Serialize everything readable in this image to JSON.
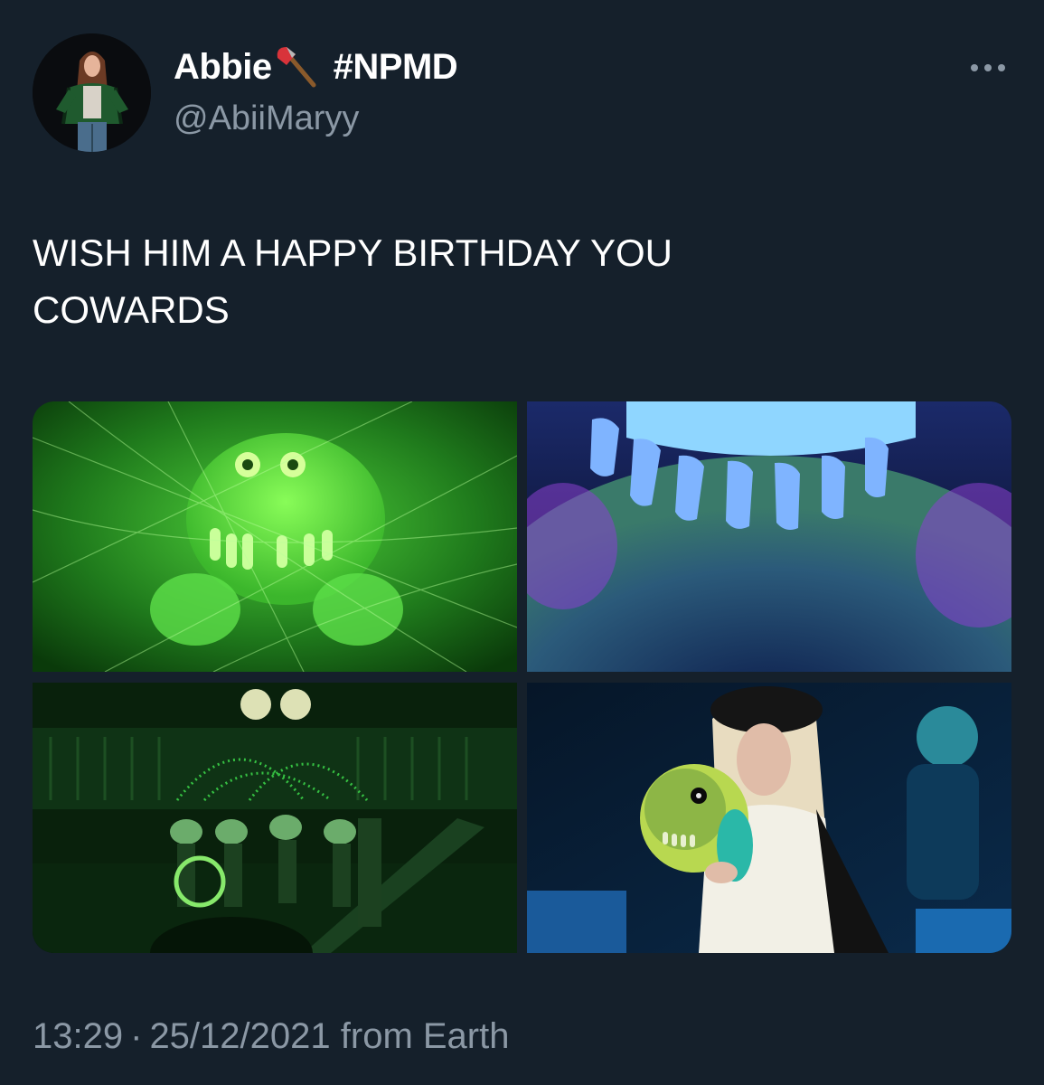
{
  "tweet": {
    "author": {
      "display_name": "Abbie",
      "name_emoji": "axe-icon",
      "hashtag": "#NPMD",
      "handle": "@AbiiMaryy"
    },
    "text": "WISH HIM A HAPPY BIRTHDAY YOU\nCOWARDS",
    "media": [
      {
        "index": 1,
        "description": "green-lit furry puppet in cobwebs"
      },
      {
        "index": 2,
        "description": "close-up of blue-lit furry puppet teeth"
      },
      {
        "index": 3,
        "description": "green-lit stage ensemble scene"
      },
      {
        "index": 4,
        "description": "performer holding green furry puppet"
      }
    ],
    "time": "13:29",
    "separator": "·",
    "date": "25/12/2021",
    "source": "from Earth"
  },
  "colors": {
    "background": "#15202b",
    "text_primary": "#ffffff",
    "text_secondary": "#8b98a5"
  }
}
